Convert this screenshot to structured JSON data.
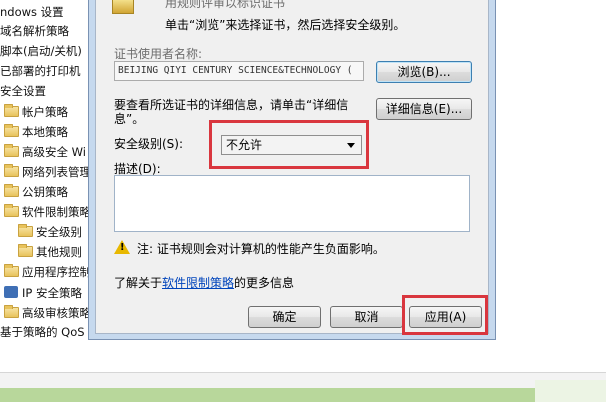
{
  "tree": {
    "items": [
      {
        "label": "ndows 设置",
        "icon": "none"
      },
      {
        "label": "域名解析策略",
        "icon": "none"
      },
      {
        "label": "脚本(启动/关机)",
        "icon": "none"
      },
      {
        "label": "已部署的打印机",
        "icon": "none"
      },
      {
        "label": "安全设置",
        "icon": "none"
      },
      {
        "label": "帐户策略",
        "icon": "folder-icon"
      },
      {
        "label": "本地策略",
        "icon": "folder-icon"
      },
      {
        "label": "高级安全 Wi",
        "icon": "folder-icon"
      },
      {
        "label": "网络列表管理",
        "icon": "folder-icon"
      },
      {
        "label": "公钥策略",
        "icon": "folder-icon"
      },
      {
        "label": "软件限制策略",
        "icon": "folder-icon"
      },
      {
        "label": "安全级别",
        "icon": "folder-icon"
      },
      {
        "label": "其他规则",
        "icon": "folder-icon"
      },
      {
        "label": "应用程序控制",
        "icon": "folder-icon"
      },
      {
        "label": "IP 安全策略",
        "icon": "network-icon"
      },
      {
        "label": "高级审核策略",
        "icon": "folder-icon"
      },
      {
        "label": "基于策略的 QoS",
        "icon": "none"
      }
    ]
  },
  "dialog": {
    "top_text_partial": "用规则评审以标识证书",
    "instruction": "单击“浏览”来选择证书，然后选择安全级别。",
    "cert_user_label": "证书使用者名称:",
    "cert_user_value": "BEIJING QIYI CENTURY SCIENCE&TECHNOLOGY (",
    "browse_button": "浏览(B)...",
    "details_text": "要查看所选证书的详细信息，请单击“详细信息”。",
    "details_button": "详细信息(E)...",
    "security_level_label": "安全级别(S):",
    "security_level_value": "不允许",
    "description_label": "描述(D):",
    "description_value": "",
    "warning_text": "注: 证书规则会对计算机的性能产生负面影响。",
    "learn_more_prefix": "了解关于",
    "learn_more_link": "软件限制策略",
    "learn_more_suffix": "的更多信息",
    "ok_button": "确定",
    "cancel_button": "取消",
    "apply_button": "应用(A)"
  },
  "colors": {
    "highlight": "#d9363e",
    "link": "#0044bb",
    "warning": "#e8b800"
  }
}
